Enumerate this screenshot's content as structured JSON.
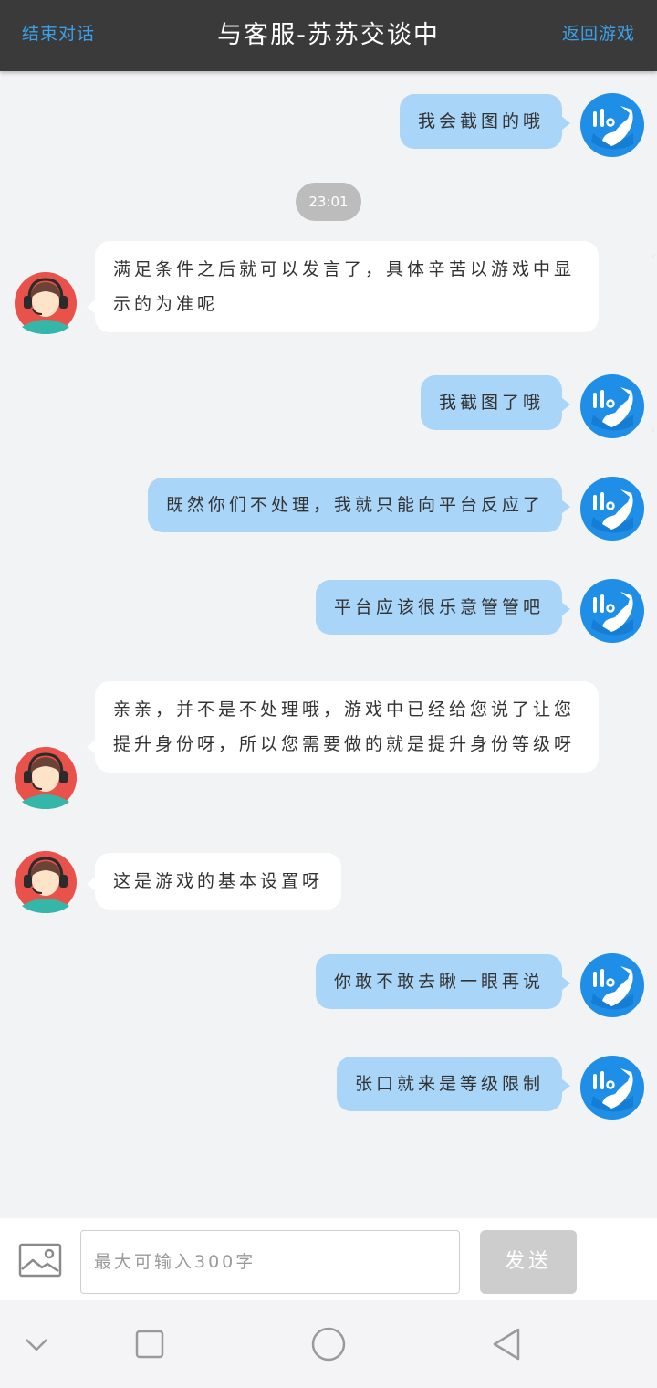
{
  "header": {
    "end_label": "结束对话",
    "title": "与客服-苏苏交谈中",
    "back_label": "返回游戏"
  },
  "messages": [
    {
      "side": "user",
      "text": "我会截图的哦"
    },
    {
      "time": "23:01"
    },
    {
      "side": "agent",
      "text": "满足条件之后就可以发言了，具体辛苦以游戏中显示的为准呢"
    },
    {
      "side": "user",
      "text": "我截图了哦"
    },
    {
      "side": "user",
      "text": "既然你们不处理，我就只能向平台反应了"
    },
    {
      "side": "user",
      "text": "平台应该很乐意管管吧"
    },
    {
      "side": "agent",
      "text": "亲亲，并不是不处理哦，游戏中已经给您说了让您提升身份呀，所以您需要做的就是提升身份等级呀"
    },
    {
      "side": "agent",
      "text": "这是游戏的基本设置呀"
    },
    {
      "side": "user",
      "text": "你敢不敢去瞅一眼再说"
    },
    {
      "side": "user",
      "text": "张口就来是等级限制"
    }
  ],
  "input": {
    "placeholder": "最大可输入300字",
    "send_label": "发送"
  },
  "icons": {
    "user_avatar": "phone-icon",
    "agent_avatar": "headset-agent-icon",
    "image_button": "image-icon",
    "nav": [
      "chevron-down-icon",
      "square-icon",
      "circle-icon",
      "back-triangle-icon"
    ]
  },
  "colors": {
    "header_bg": "#3a3a3a",
    "header_link": "#3aa0e8",
    "user_bubble": "#a9d5f8",
    "agent_bubble": "#ffffff",
    "chat_bg": "#f2f3f5",
    "send_button": "#cdcdcd",
    "avatar_blue": "#1e8ee6"
  }
}
